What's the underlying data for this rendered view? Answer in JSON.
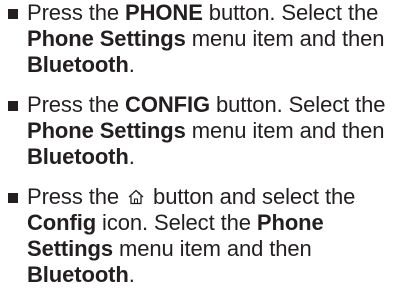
{
  "steps": [
    {
      "p1": "Press the ",
      "b1": "PHONE",
      "p2": " button. Select the ",
      "b2": "Phone Settings",
      "p3": " menu item and then ",
      "b3": "Bluetooth",
      "p4": "."
    },
    {
      "p1": "Press the ",
      "b1": "CONFIG",
      "p2": " button. Select the ",
      "b2": "Phone Settings",
      "p3": " menu item and then ",
      "b3": "Bluetooth",
      "p4": "."
    },
    {
      "p1": "Press the ",
      "icon": "home-icon",
      "p2": " button and select the ",
      "b1": "Config",
      "p3": " icon. Select the ",
      "b2": "Phone Settings",
      "p4": " menu item and then ",
      "b3": "Bluetooth",
      "p5": "."
    }
  ]
}
